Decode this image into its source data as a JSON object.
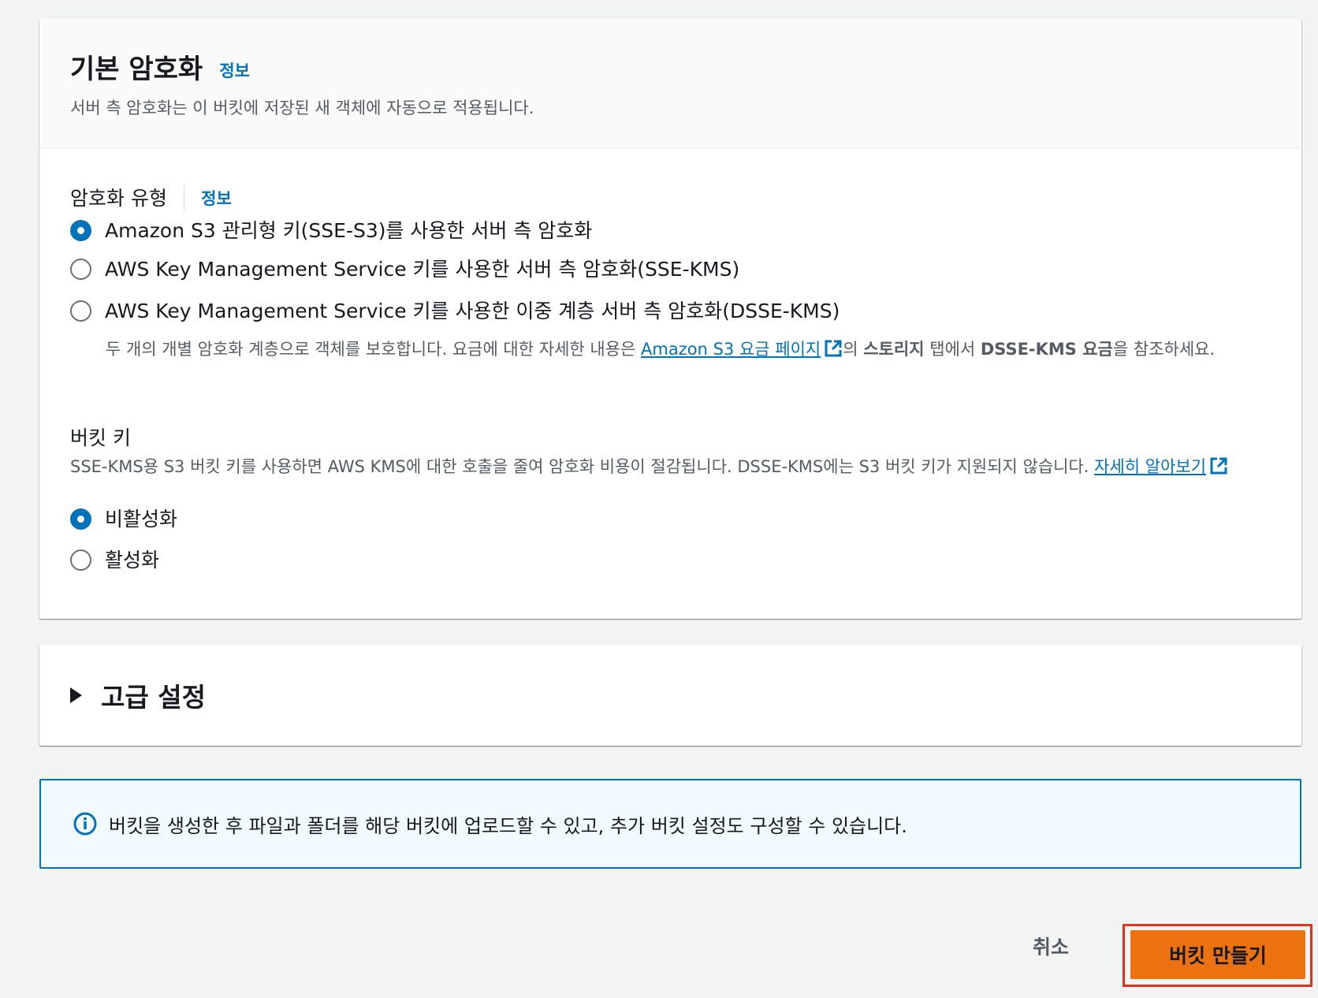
{
  "encryption": {
    "title": "기본 암호화",
    "info_link": "정보",
    "description": "서버 측 암호화는 이 버킷에 저장된 새 객체에 자동으로 적용됩니다.",
    "type_label": "암호화 유형",
    "type_info_link": "정보",
    "options": [
      {
        "label": "Amazon S3 관리형 키(SSE-S3)를 사용한 서버 측 암호화",
        "selected": true
      },
      {
        "label": "AWS Key Management Service 키를 사용한 서버 측 암호화(SSE-KMS)",
        "selected": false
      },
      {
        "label": "AWS Key Management Service 키를 사용한 이중 계층 서버 측 암호화(DSSE-KMS)",
        "selected": false
      }
    ],
    "dsse_note": {
      "prefix": "두 개의 개별 암호화 계층으로 객체를 보호합니다. 요금에 대한 자세한 내용은 ",
      "link": "Amazon S3 요금 페이지",
      "middle1": "의 ",
      "bold1": "스토리지",
      "middle2": " 탭에서 ",
      "bold2": "DSSE-KMS 요금",
      "suffix": "을 참조하세요."
    }
  },
  "bucket_key": {
    "label": "버킷 키",
    "description": "SSE-KMS용 S3 버킷 키를 사용하면 AWS KMS에 대한 호출을 줄여 암호화 비용이 절감됩니다. DSSE-KMS에는 S3 버킷 키가 지원되지 않습니다. ",
    "learn_more_link": "자세히 알아보기",
    "options": [
      {
        "label": "비활성화",
        "selected": true
      },
      {
        "label": "활성화",
        "selected": false
      }
    ]
  },
  "advanced": {
    "title": "고급 설정",
    "expanded": false
  },
  "info_banner": {
    "text": "버킷을 생성한 후 파일과 폴더를 해당 버킷에 업로드할 수 있고, 추가 버킷 설정도 구성할 수 있습니다."
  },
  "actions": {
    "cancel_label": "취소",
    "create_label": "버킷 만들기"
  },
  "colors": {
    "link": "#0073bb",
    "primary_button": "#ec7211",
    "highlight": "#e0321e",
    "banner_bg": "#f1faff"
  }
}
